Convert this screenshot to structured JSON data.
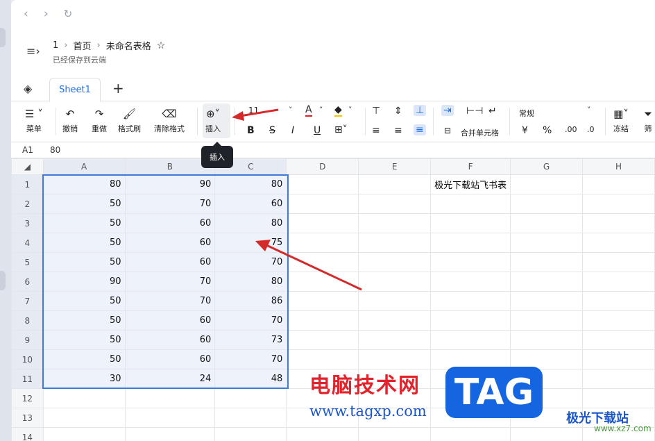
{
  "nav": {
    "back": "‹",
    "forward": "›",
    "refresh": "↻"
  },
  "header": {
    "crumb_root": "1",
    "crumb_home": "首页",
    "crumb_doc": "未命名表格",
    "saved": "已经保存到云端"
  },
  "tabs": {
    "sheet": "Sheet1",
    "add": "+"
  },
  "toolbar": {
    "menu": "菜单",
    "undo": "撤销",
    "redo": "重做",
    "format_brush": "格式刷",
    "clear_format": "清除格式",
    "insert": "插入",
    "font_size": "11",
    "merge": "合并单元格",
    "number_format": "常规",
    "freeze": "冻结",
    "filter": "筛"
  },
  "tooltip": "插入",
  "formula": {
    "ref": "A1",
    "value": "80"
  },
  "columns": [
    "A",
    "B",
    "C",
    "D",
    "E",
    "F",
    "G",
    "H"
  ],
  "rows": [
    {
      "n": "1",
      "a": "80",
      "b": "90",
      "c": "80",
      "f": "极光下载站飞书表"
    },
    {
      "n": "2",
      "a": "50",
      "b": "70",
      "c": "60",
      "f": ""
    },
    {
      "n": "3",
      "a": "50",
      "b": "60",
      "c": "80",
      "f": ""
    },
    {
      "n": "4",
      "a": "50",
      "b": "60",
      "c": "75",
      "f": ""
    },
    {
      "n": "5",
      "a": "50",
      "b": "60",
      "c": "70",
      "f": ""
    },
    {
      "n": "6",
      "a": "90",
      "b": "70",
      "c": "80",
      "f": ""
    },
    {
      "n": "7",
      "a": "50",
      "b": "70",
      "c": "86",
      "f": ""
    },
    {
      "n": "8",
      "a": "50",
      "b": "60",
      "c": "70",
      "f": ""
    },
    {
      "n": "9",
      "a": "50",
      "b": "60",
      "c": "73",
      "f": ""
    },
    {
      "n": "10",
      "a": "50",
      "b": "60",
      "c": "70",
      "f": ""
    },
    {
      "n": "11",
      "a": "30",
      "b": "24",
      "c": "48",
      "f": ""
    },
    {
      "n": "12",
      "a": "",
      "b": "",
      "c": "",
      "f": ""
    },
    {
      "n": "13",
      "a": "",
      "b": "",
      "c": "",
      "f": ""
    },
    {
      "n": "14",
      "a": "",
      "b": "",
      "c": "",
      "f": ""
    }
  ],
  "watermark": {
    "cn": "电脑技术网",
    "url": "www.tagxp.com",
    "tag": "TAG",
    "site": "极光下载站",
    "site_url": "www.xz7.com"
  },
  "colors": {
    "accent": "#1f6fe8",
    "arrow": "#d42a2a",
    "selection": "#3f7ad6"
  }
}
